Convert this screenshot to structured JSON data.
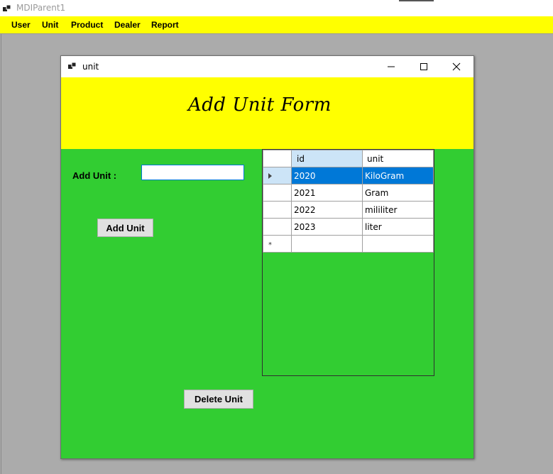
{
  "parent_window": {
    "title": "MDIParent1"
  },
  "menu": {
    "items": [
      {
        "label": "User"
      },
      {
        "label": "Unit"
      },
      {
        "label": "Product"
      },
      {
        "label": "Dealer"
      },
      {
        "label": "Report"
      }
    ]
  },
  "child_window": {
    "title": "unit"
  },
  "form": {
    "heading": "Add Unit Form",
    "add_unit_label": "Add Unit :",
    "add_unit_value": "",
    "add_button": "Add Unit",
    "delete_button": "Delete Unit"
  },
  "grid": {
    "columns": [
      "id",
      "unit"
    ],
    "rows": [
      {
        "id": "2020",
        "unit": "KiloGram",
        "selected": true
      },
      {
        "id": "2021",
        "unit": "Gram",
        "selected": false
      },
      {
        "id": "2022",
        "unit": "mililiter",
        "selected": false
      },
      {
        "id": "2023",
        "unit": "liter",
        "selected": false
      }
    ]
  },
  "colors": {
    "menu_background": "#ffff00",
    "form_background": "#32cd32",
    "header_background": "#ffff00",
    "selection": "#0078d7",
    "mdi_background": "#ababab"
  },
  "icons": [
    "app-icon",
    "form-icon",
    "minimize-icon",
    "maximize-icon",
    "close-icon",
    "current-row-icon",
    "new-row-icon"
  ]
}
